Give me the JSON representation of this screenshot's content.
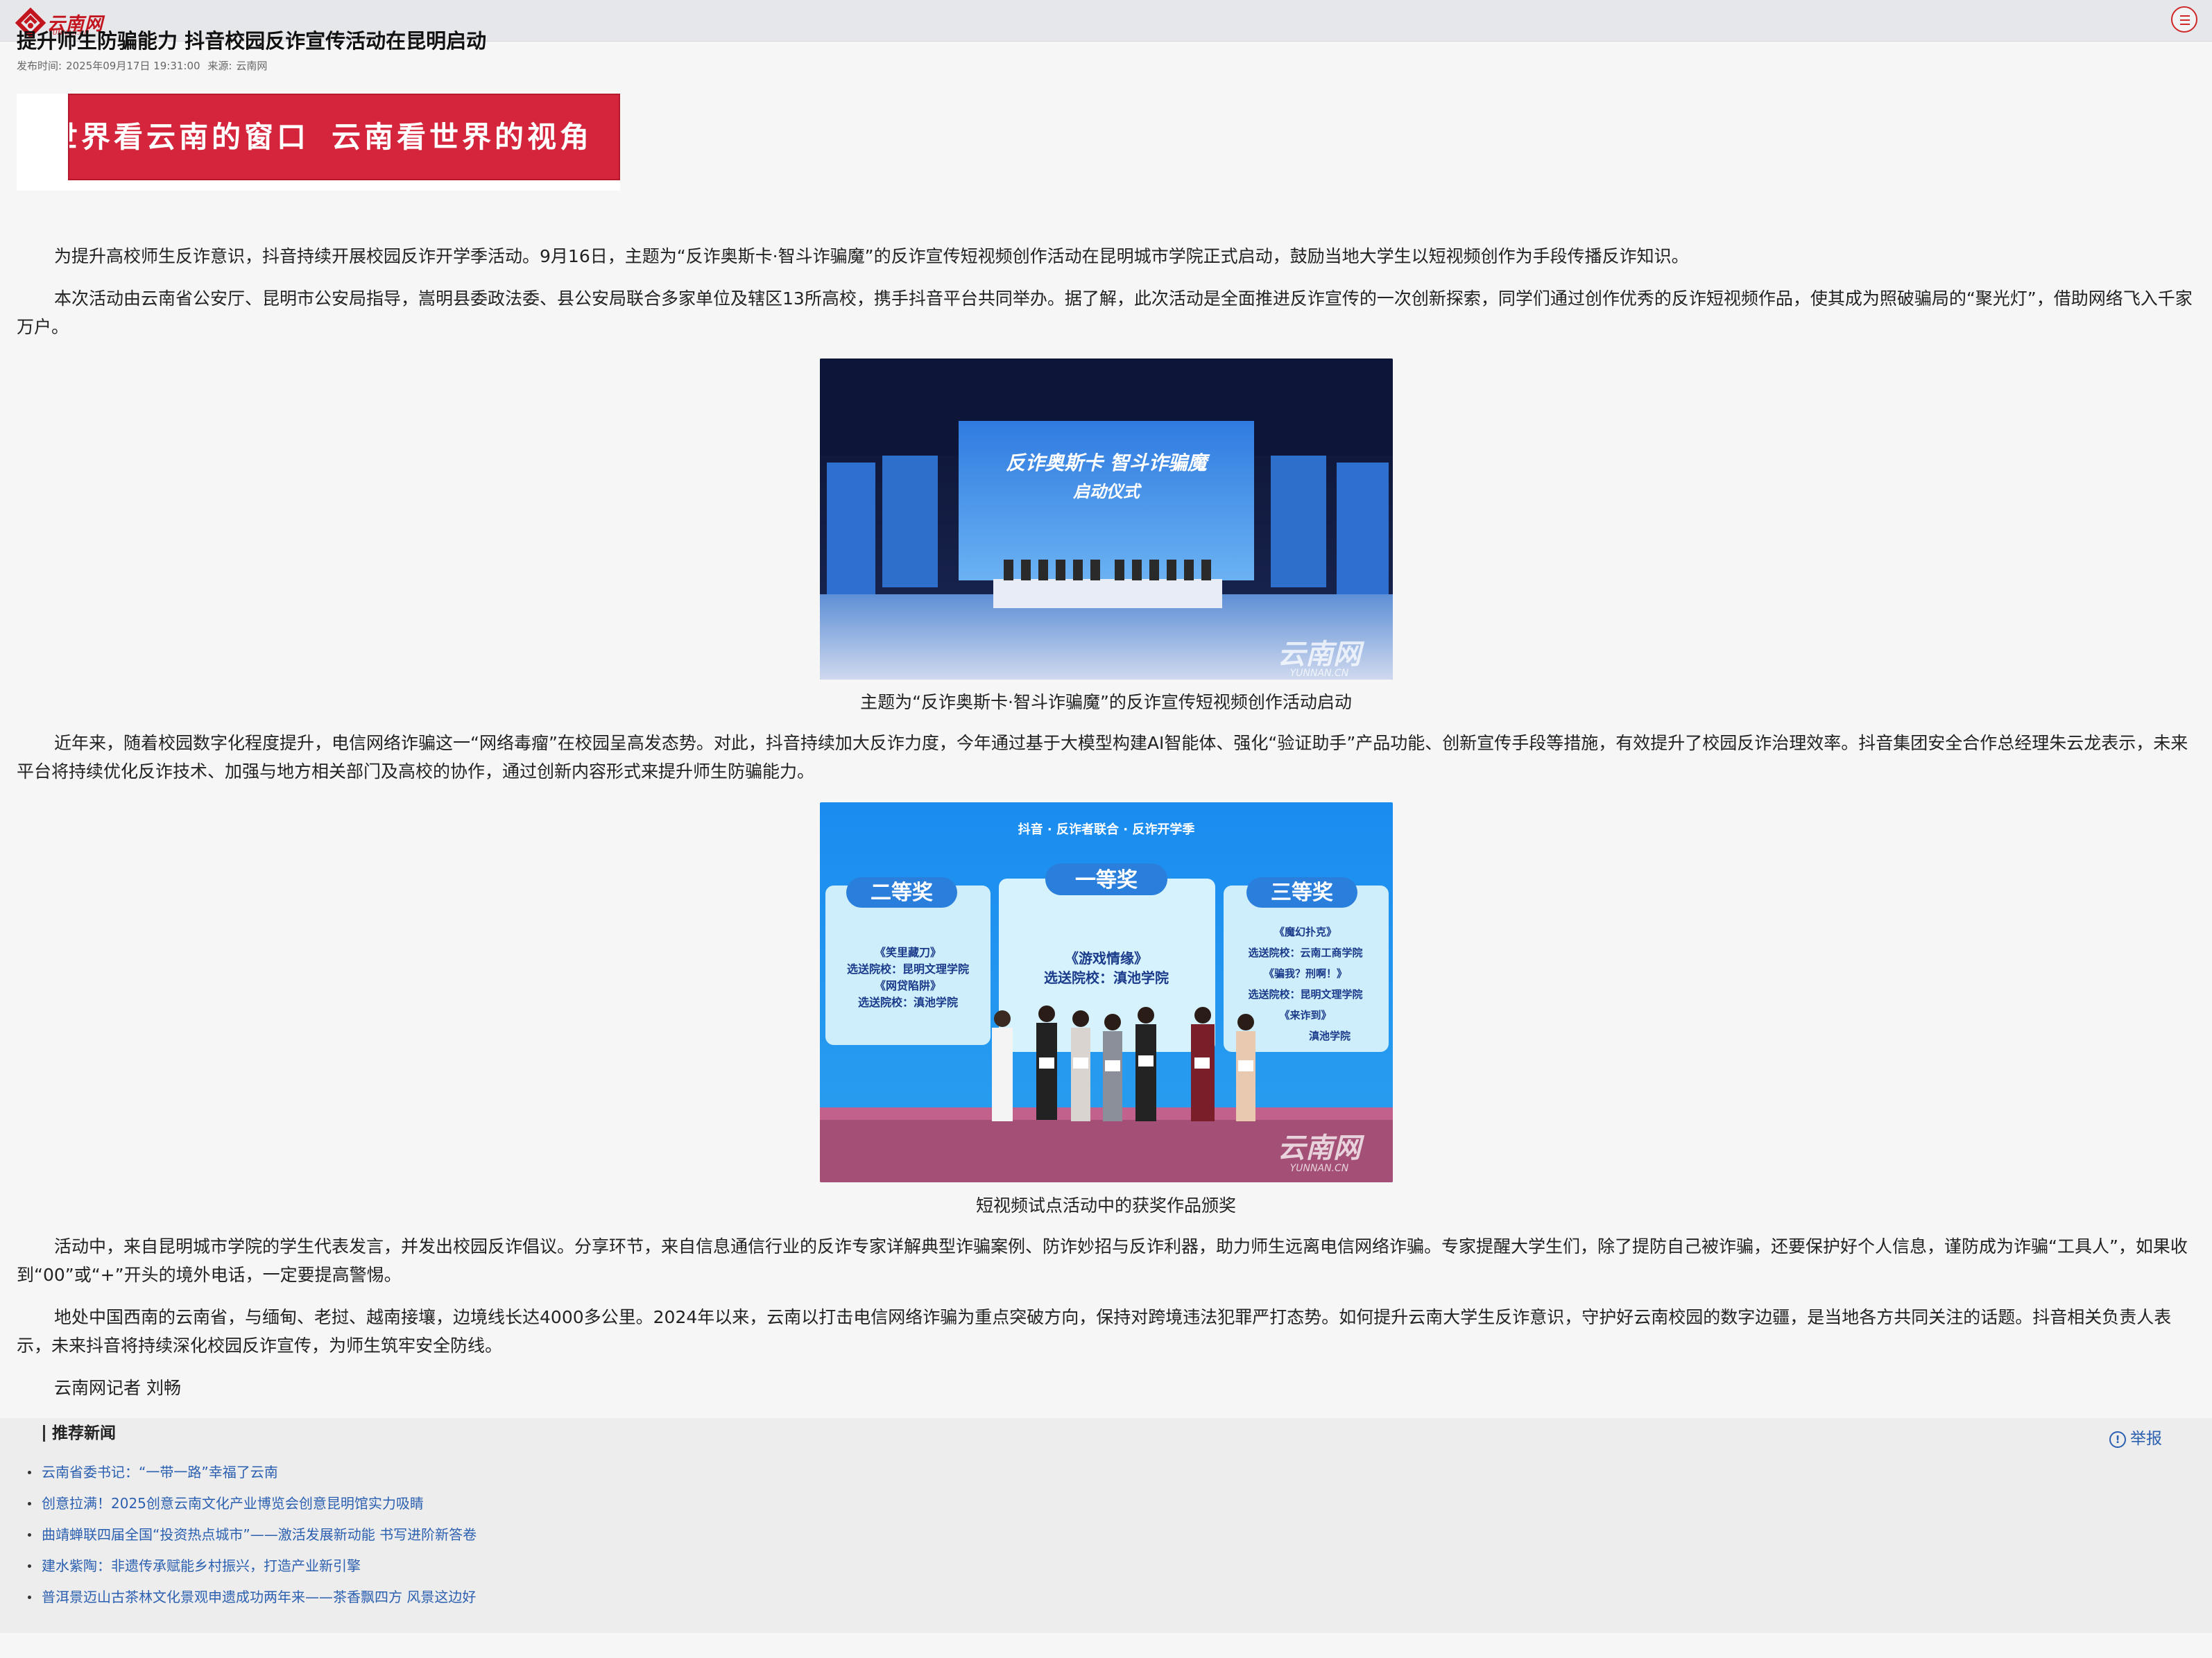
{
  "site": {
    "logo_text": "云南网",
    "logo_sub": "YUNNAN.CN"
  },
  "article": {
    "title": "提升师生防骗能力 抖音校园反诈宣传活动在昆明启动",
    "publish_label": "发布时间:",
    "publish_time": "2025年09月17日 19:31:00",
    "source_label": "来源:",
    "source": "云南网",
    "banner_text_left": "世界看云南的窗口",
    "banner_text_right": "云南看世界的视角",
    "paragraphs": [
      "为提升高校师生反诈意识，抖音持续开展校园反诈开学季活动。9月16日，主题为“反诈奥斯卡·智斗诈骗魔”的反诈宣传短视频创作活动在昆明城市学院正式启动，鼓励当地大学生以短视频创作为手段传播反诈知识。",
      "本次活动由云南省公安厅、昆明市公安局指导，嵩明县委政法委、县公安局联合多家单位及辖区13所高校，携手抖音平台共同举办。据了解，此次活动是全面推进反诈宣传的一次创新探索，同学们通过创作优秀的反诈短视频作品，使其成为照破骗局的“聚光灯”，借助网络飞入千家万户。",
      "近年来，随着校园数字化程度提升，电信网络诈骗这一“网络毒瘤”在校园呈高发态势。对此，抖音持续加大反诈力度，今年通过基于大模型构建AI智能体、强化“验证助手”产品功能、创新宣传手段等措施，有效提升了校园反诈治理效率。抖音集团安全合作总经理朱云龙表示，未来平台将持续优化反诈技术、加强与地方相关部门及高校的协作，通过创新内容形式来提升师生防骗能力。",
      "活动中，来自昆明城市学院的学生代表发言，并发出校园反诈倡议。分享环节，来自信息通信行业的反诈专家详解典型诈骗案例、防诈妙招与反诈利器，助力师生远离电信网络诈骗。专家提醒大学生们，除了提防自己被诈骗，还要保护好个人信息，谨防成为诈骗“工具人”，如果收到“00”或“+”开头的境外电话，一定要提高警惕。",
      "地处中国西南的云南省，与缅甸、老挝、越南接壤，边境线长达4000多公里。2024年以来，云南以打击电信网络诈骗为重点突破方向，保持对跨境违法犯罪严打态势。如何提升云南大学生反诈意识，守护好云南校园的数字边疆，是当地各方共同关注的话题。抖音相关负责人表示，未来抖音将持续深化校园反诈宣传，为师生筑牢安全防线。",
      "云南网记者 刘畅"
    ],
    "photo1": {
      "caption": "主题为“反诈奥斯卡·智斗诈骗魔”的反诈宣传短视频创作活动启动",
      "screen_title_1": "反诈奥斯卡 智斗诈骗魔",
      "screen_title_2": "启动仪式",
      "watermark": "云南网",
      "watermark_sub": "YUNNAN.CN"
    },
    "photo2": {
      "caption": "短视频试点活动中的获奖作品颁奖",
      "first_prize": "一等奖",
      "second_prize": "二等奖",
      "third_prize": "三等奖",
      "first_line1": "《游戏情缘》",
      "first_line2": "选送院校：滇池学院",
      "second_line1": "《笑里藏刀》",
      "second_line2": "选送院校：昆明文理学院",
      "second_line3": "《网贷陷阱》",
      "second_line4": "选送院校：滇池学院",
      "third_line1": "《魔幻扑克》",
      "third_line2": "选送院校：云南工商学院",
      "third_line3": "《骗我？刑啊！》",
      "third_line4": "选送院校：昆明文理学院",
      "third_line5": "《来诈到》",
      "third_line6": "滇池学院",
      "logos_text": "抖音 · 反诈者联合 · 反诈开学季",
      "watermark": "云南网",
      "watermark_sub": "YUNNAN.CN"
    }
  },
  "recommend": {
    "title": "推荐新闻",
    "report_label": "举报",
    "items": [
      "云南省委书记：“一带一路”幸福了云南",
      "创意拉满！2025创意云南文化产业博览会创意昆明馆实力吸睛",
      "曲靖蝉联四届全国“投资热点城市”——激活发展新动能 书写进阶新答卷",
      "建水紫陶：非遗传承赋能乡村振兴，打造产业新引擎",
      "普洱景迈山古茶林文化景观申遗成功两年来——茶香飘四方 风景这边好"
    ]
  },
  "colors": {
    "brand_red": "#c3151e",
    "link_blue": "#2b5fb0",
    "banner_red": "#d5253d"
  },
  "icons": [
    "logo-mark-icon",
    "menu-icon",
    "report-alert-icon"
  ]
}
